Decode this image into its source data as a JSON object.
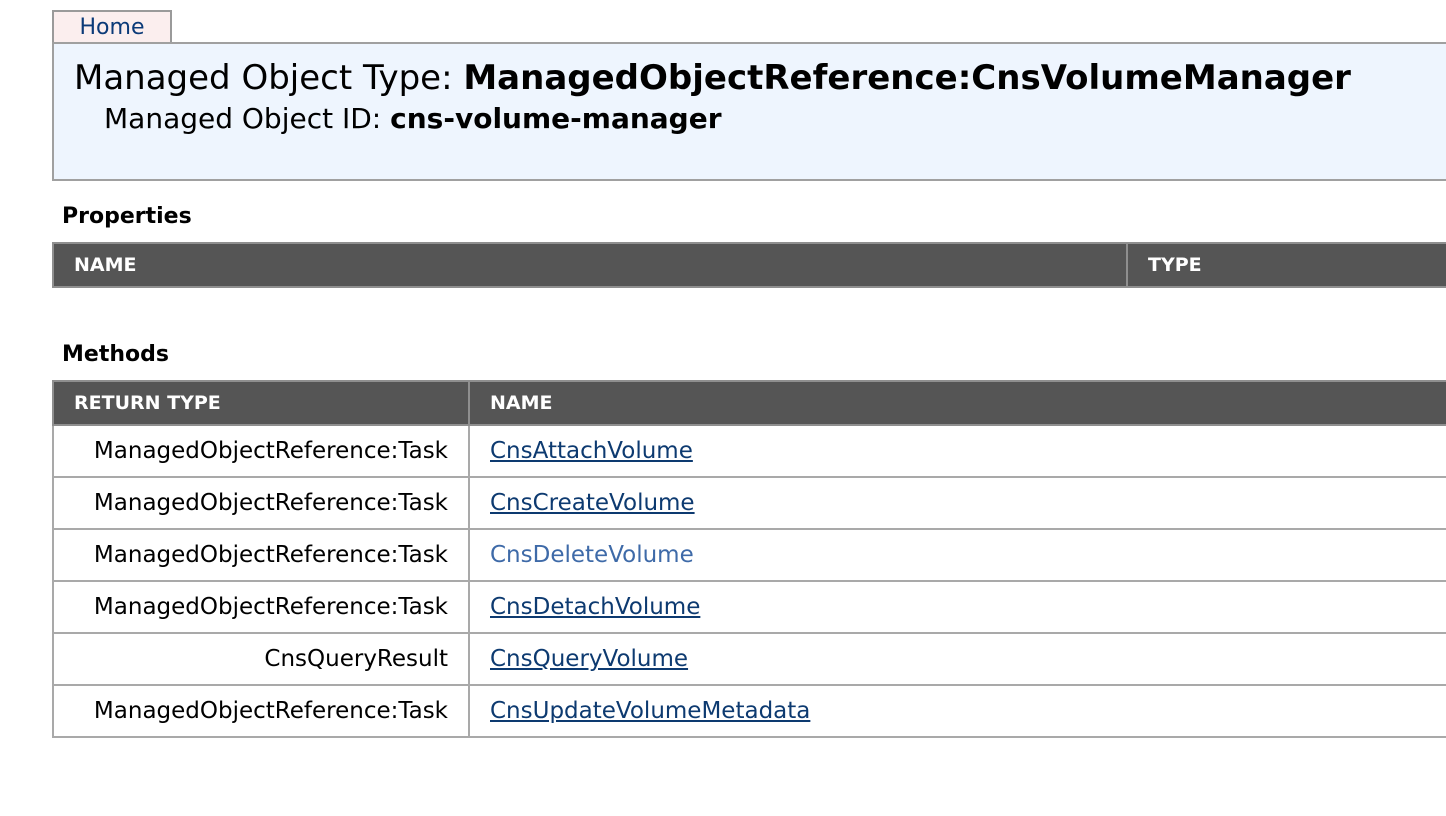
{
  "nav": {
    "home_label": "Home"
  },
  "header": {
    "type_label": "Managed Object Type: ",
    "type_value": "ManagedObjectReference:CnsVolumeManager",
    "id_label": "Managed Object ID: ",
    "id_value": "cns-volume-manager"
  },
  "properties": {
    "heading": "Properties",
    "columns": [
      "NAME",
      "TYPE"
    ]
  },
  "methods": {
    "heading": "Methods",
    "columns": [
      "RETURN TYPE",
      "NAME"
    ],
    "rows": [
      {
        "return_type": "ManagedObjectReference:Task",
        "name": "CnsAttachVolume"
      },
      {
        "return_type": "ManagedObjectReference:Task",
        "name": "CnsCreateVolume"
      },
      {
        "return_type": "ManagedObjectReference:Task",
        "name": "CnsDeleteVolume"
      },
      {
        "return_type": "ManagedObjectReference:Task",
        "name": "CnsDetachVolume"
      },
      {
        "return_type": "CnsQueryResult",
        "name": "CnsQueryVolume"
      },
      {
        "return_type": "ManagedObjectReference:Task",
        "name": "CnsUpdateVolumeMetadata"
      }
    ]
  },
  "colors": {
    "header_bg": "#eef5fe",
    "table_header_bg": "#555555",
    "link": "#0d3a70",
    "link_hover": "#3e6aa8",
    "home_tab_bg": "#fbeeee"
  }
}
